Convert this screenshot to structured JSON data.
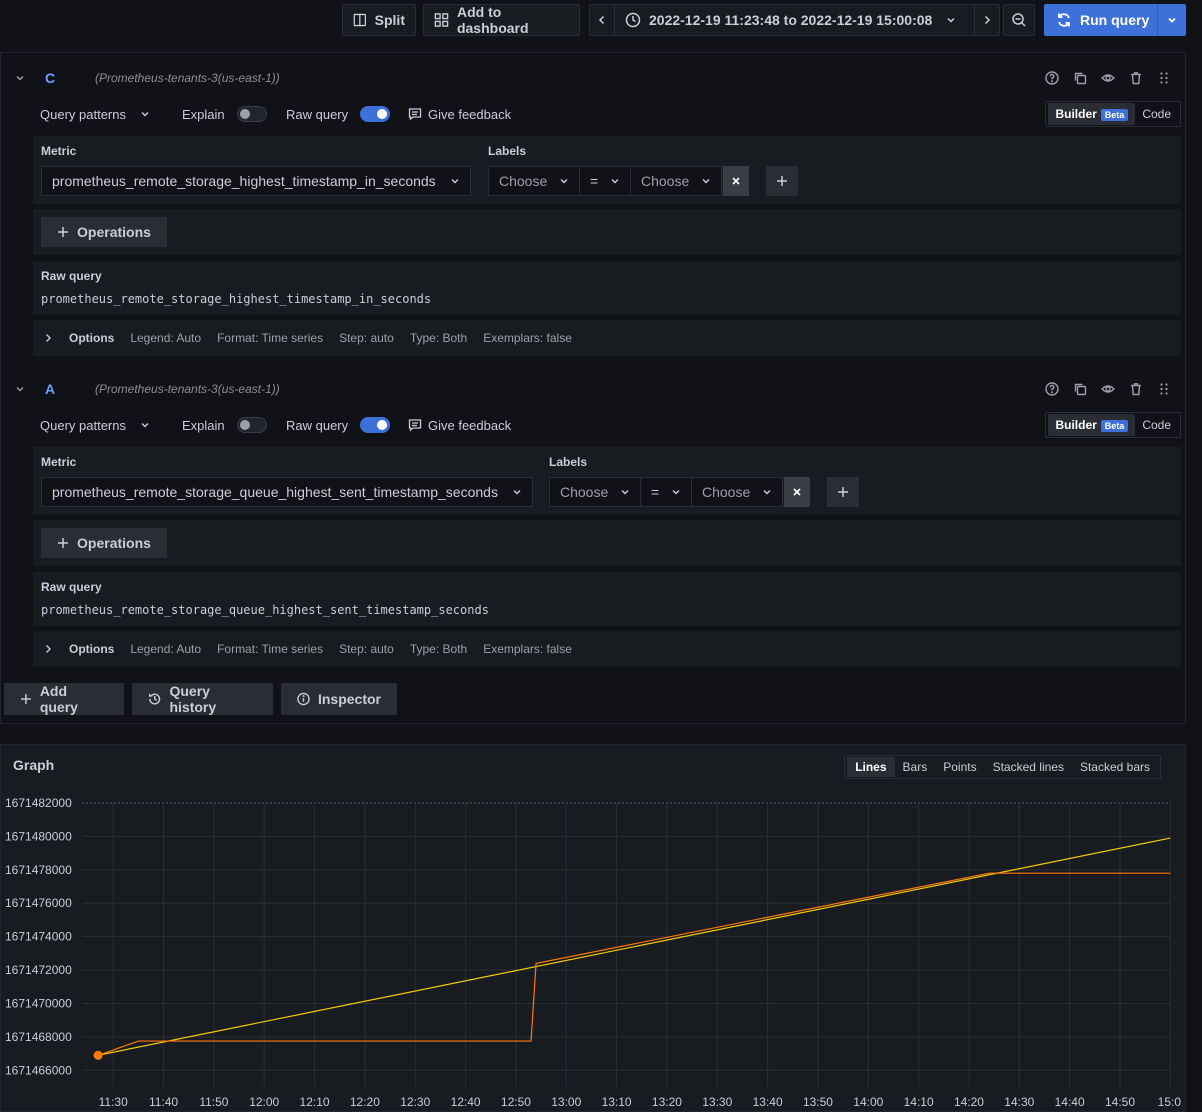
{
  "toolbar": {
    "split_label": "Split",
    "add_dashboard_label": "Add to dashboard",
    "time_range": "2022-12-19 11:23:48 to 2022-12-19 15:00:08",
    "run_query_label": "Run query"
  },
  "queries": [
    {
      "ref_id": "C",
      "datasource": "(Prometheus-tenants-3(us-east-1))",
      "query_patterns_label": "Query patterns",
      "explain_label": "Explain",
      "raw_query_toggle_label": "Raw query",
      "feedback_label": "Give feedback",
      "builder_label": "Builder",
      "beta_label": "Beta",
      "code_label": "Code",
      "metric_label": "Metric",
      "metric_value": "prometheus_remote_storage_highest_timestamp_in_seconds",
      "labels_label": "Labels",
      "label_key_placeholder": "Choose",
      "label_op": "=",
      "label_value_placeholder": "Choose",
      "operations_label": "Operations",
      "raw_query_label": "Raw query",
      "raw_query": "prometheus_remote_storage_highest_timestamp_in_seconds",
      "options_label": "Options",
      "legend": "Legend: Auto",
      "format": "Format: Time series",
      "step": "Step: auto",
      "type": "Type: Both",
      "exemplars": "Exemplars: false"
    },
    {
      "ref_id": "A",
      "datasource": "(Prometheus-tenants-3(us-east-1))",
      "query_patterns_label": "Query patterns",
      "explain_label": "Explain",
      "raw_query_toggle_label": "Raw query",
      "feedback_label": "Give feedback",
      "builder_label": "Builder",
      "beta_label": "Beta",
      "code_label": "Code",
      "metric_label": "Metric",
      "metric_value": "prometheus_remote_storage_queue_highest_sent_timestamp_seconds",
      "labels_label": "Labels",
      "label_key_placeholder": "Choose",
      "label_op": "=",
      "label_value_placeholder": "Choose",
      "operations_label": "Operations",
      "raw_query_label": "Raw query",
      "raw_query": "prometheus_remote_storage_queue_highest_sent_timestamp_seconds",
      "options_label": "Options",
      "legend": "Legend: Auto",
      "format": "Format: Time series",
      "step": "Step: auto",
      "type": "Type: Both",
      "exemplars": "Exemplars: false"
    }
  ],
  "actions": {
    "add_query": "Add query",
    "query_history": "Query history",
    "inspector": "Inspector"
  },
  "graph": {
    "title": "Graph",
    "view_options": [
      "Lines",
      "Bars",
      "Points",
      "Stacked lines",
      "Stacked bars"
    ],
    "active_view": "Lines"
  },
  "colors": {
    "series_highest_timestamp": "#f2cc0c",
    "series_queue_sent": "#ff780a",
    "accent": "#3d71d9"
  },
  "chart_data": {
    "type": "line",
    "title": "",
    "xlabel": "",
    "ylabel": "",
    "x_ticks": [
      "11:30",
      "11:40",
      "11:50",
      "12:00",
      "12:10",
      "12:20",
      "12:30",
      "12:40",
      "12:50",
      "13:00",
      "13:10",
      "13:20",
      "13:30",
      "13:40",
      "13:50",
      "14:00",
      "14:10",
      "14:20",
      "14:30",
      "14:40",
      "14:50",
      "15:0"
    ],
    "y_ticks": [
      1671466000,
      1671468000,
      1671470000,
      1671472000,
      1671474000,
      1671476000,
      1671478000,
      1671480000,
      1671482000
    ],
    "xlim": [
      "11:23:48",
      "15:00:08"
    ],
    "ylim": [
      1671465000,
      1671482000
    ],
    "series": [
      {
        "color": "#f2cc0c",
        "points": [
          [
            "11:27",
            1671466900
          ],
          [
            "15:00",
            1671479900
          ]
        ]
      },
      {
        "color": "#ff780a",
        "points": [
          [
            "11:27",
            1671466900
          ],
          [
            "11:35",
            1671467750
          ],
          [
            "12:53",
            1671467750
          ],
          [
            "12:54",
            1671472400
          ],
          [
            "14:24",
            1671477800
          ],
          [
            "15:00",
            1671477800
          ]
        ]
      }
    ],
    "grid": true
  }
}
